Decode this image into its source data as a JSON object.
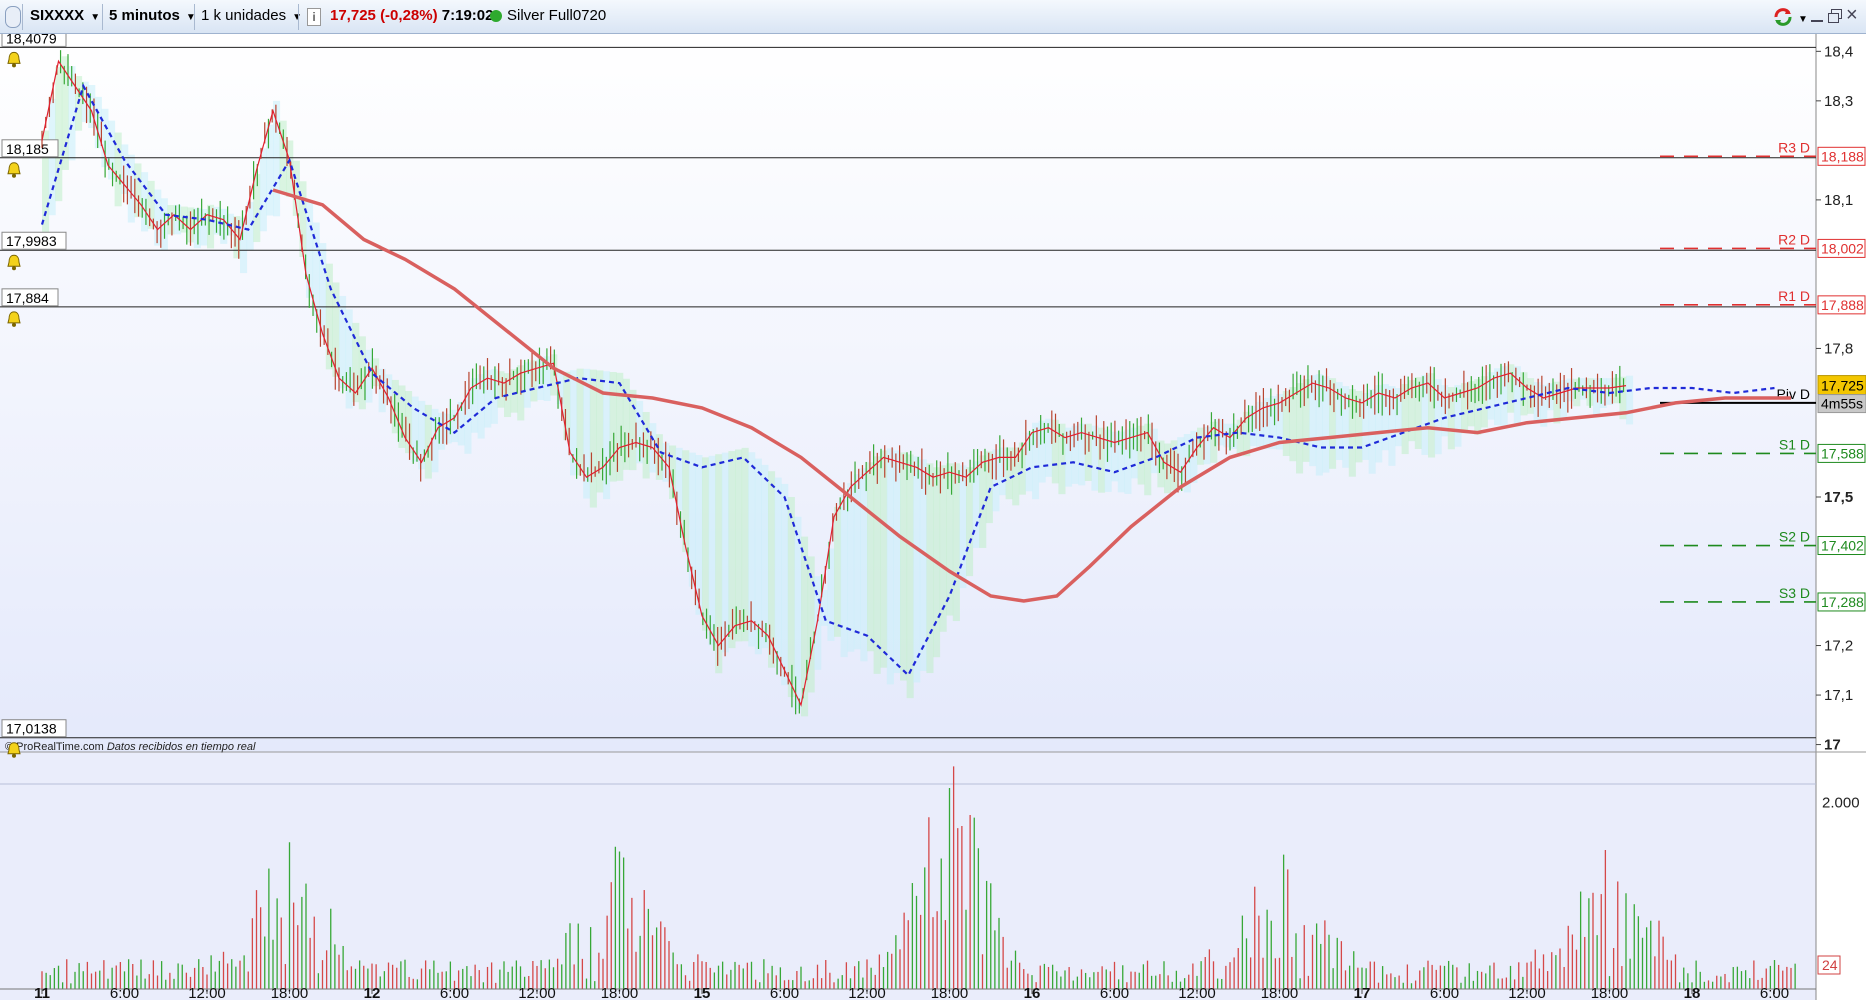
{
  "toolbar": {
    "symbol": "SIXXXX",
    "timeframe": "5 minutos",
    "units": "1 k unidades",
    "price": "17,725",
    "change": "(-0,28%)",
    "time": "7:19:02",
    "account": "Silver Full0720",
    "colors": {
      "price": "#cc0000",
      "status_dot": "#2eaa2e"
    }
  },
  "footer": {
    "copyright": "© ProRealTime.com",
    "note": "Datos recibidos en tiempo real"
  },
  "chart_data": {
    "type": "line",
    "price_panel": {
      "ylim": [
        16.985,
        18.435
      ],
      "y_ticks": [
        {
          "v": 18.4,
          "label": "18,4"
        },
        {
          "v": 18.3,
          "label": "18,3"
        },
        {
          "v": 18.1,
          "label": "18,1"
        },
        {
          "v": 17.8,
          "label": "17,8"
        },
        {
          "v": 17.5,
          "label": "17,5"
        },
        {
          "v": 17.2,
          "label": "17,2"
        },
        {
          "v": 17.1,
          "label": "17,1"
        },
        {
          "v": 17.0,
          "label": "17"
        }
      ],
      "horizontal_lines": [
        {
          "v": 18.4079,
          "label": "18,4079"
        },
        {
          "v": 18.185,
          "label": "18,185"
        },
        {
          "v": 17.9983,
          "label": "17,9983"
        },
        {
          "v": 17.884,
          "label": "17,884"
        },
        {
          "v": 17.0138,
          "label": "17,0138"
        }
      ],
      "pivots": [
        {
          "name": "R3 D",
          "v": 18.188,
          "label": "18,188",
          "color": "#e03030"
        },
        {
          "name": "R2 D",
          "v": 18.002,
          "label": "18,002",
          "color": "#e03030"
        },
        {
          "name": "R1 D",
          "v": 17.888,
          "label": "17,888",
          "color": "#e03030"
        },
        {
          "name": "Piv D",
          "v": 17.69,
          "label": "",
          "color": "#000000"
        },
        {
          "name": "S1 D",
          "v": 17.588,
          "label": "17,588",
          "color": "#1e8a1e"
        },
        {
          "name": "S2 D",
          "v": 17.402,
          "label": "17,402",
          "color": "#1e8a1e"
        },
        {
          "name": "S3 D",
          "v": 17.288,
          "label": "17,288",
          "color": "#1e8a1e"
        }
      ],
      "last_price": {
        "v": 17.725,
        "label": "17,725",
        "countdown": "4m55s"
      },
      "x_ticks": [
        {
          "x": 0,
          "label": "11",
          "major": true
        },
        {
          "x": 1,
          "label": "6:00"
        },
        {
          "x": 2,
          "label": "12:00"
        },
        {
          "x": 3,
          "label": "18:00"
        },
        {
          "x": 4,
          "label": "12",
          "major": true
        },
        {
          "x": 5,
          "label": "6:00"
        },
        {
          "x": 6,
          "label": "12:00"
        },
        {
          "x": 7,
          "label": "18:00"
        },
        {
          "x": 8,
          "label": "15",
          "major": true
        },
        {
          "x": 9,
          "label": "6:00"
        },
        {
          "x": 10,
          "label": "12:00"
        },
        {
          "x": 11,
          "label": "18:00"
        },
        {
          "x": 12,
          "label": "16",
          "major": true
        },
        {
          "x": 13,
          "label": "6:00"
        },
        {
          "x": 14,
          "label": "12:00"
        },
        {
          "x": 15,
          "label": "18:00"
        },
        {
          "x": 16,
          "label": "17",
          "major": true
        },
        {
          "x": 17,
          "label": "6:00"
        },
        {
          "x": 18,
          "label": "12:00"
        },
        {
          "x": 19,
          "label": "18:00"
        },
        {
          "x": 20,
          "label": "18",
          "major": true
        },
        {
          "x": 21,
          "label": "6:00"
        }
      ],
      "price_series": {
        "name": "",
        "x": [
          0,
          0.2,
          0.4,
          0.6,
          0.8,
          1.0,
          1.2,
          1.4,
          1.6,
          1.8,
          2.0,
          2.2,
          2.4,
          2.6,
          2.8,
          3.0,
          3.2,
          3.4,
          3.6,
          3.8,
          4.0,
          4.2,
          4.4,
          4.6,
          4.8,
          5.0,
          5.2,
          5.4,
          5.6,
          5.8,
          6.0,
          6.2,
          6.4,
          6.6,
          6.8,
          7.0,
          7.2,
          7.4,
          7.6,
          7.8,
          8.0,
          8.2,
          8.4,
          8.6,
          8.8,
          9.0,
          9.2,
          9.4,
          9.6,
          9.8,
          10.0,
          10.2,
          10.4,
          10.6,
          10.8,
          11.0,
          11.2,
          11.4,
          11.6,
          11.8,
          12.0,
          12.2,
          12.4,
          12.6,
          12.8,
          13.0,
          13.2,
          13.4,
          13.6,
          13.8,
          14.0,
          14.2,
          14.4,
          14.6,
          14.8,
          15.0,
          15.2,
          15.4,
          15.6,
          15.8,
          16.0,
          16.2,
          16.4,
          16.6,
          16.8,
          17.0,
          17.2,
          17.4,
          17.6,
          17.8,
          18.0,
          18.2,
          18.4,
          18.6,
          18.8,
          19.0,
          19.2,
          19.4,
          19.6,
          19.8,
          20.0,
          20.2,
          20.4,
          20.6,
          20.8,
          21.0,
          21.2
        ],
        "y": [
          18.22,
          18.38,
          18.33,
          18.28,
          18.17,
          18.13,
          18.09,
          18.04,
          18.07,
          18.04,
          18.07,
          18.06,
          18.02,
          18.16,
          18.28,
          18.18,
          17.95,
          17.83,
          17.74,
          17.71,
          17.76,
          17.7,
          17.62,
          17.57,
          17.64,
          17.66,
          17.72,
          17.74,
          17.73,
          17.75,
          17.76,
          17.77,
          17.59,
          17.54,
          17.56,
          17.6,
          17.61,
          17.6,
          17.56,
          17.4,
          17.26,
          17.2,
          17.24,
          17.25,
          17.22,
          17.15,
          17.08,
          17.25,
          17.46,
          17.52,
          17.55,
          17.58,
          17.57,
          17.56,
          17.54,
          17.55,
          17.54,
          17.57,
          17.58,
          17.58,
          17.63,
          17.64,
          17.62,
          17.63,
          17.62,
          17.61,
          17.62,
          17.63,
          17.57,
          17.55,
          17.6,
          17.64,
          17.62,
          17.66,
          17.68,
          17.69,
          17.71,
          17.73,
          17.72,
          17.7,
          17.69,
          17.71,
          17.7,
          17.72,
          17.73,
          17.7,
          17.71,
          17.72,
          17.74,
          17.75,
          17.72,
          17.7,
          17.71,
          17.72,
          17.72,
          17.72,
          17.725
        ]
      },
      "ma_fast": {
        "name": "",
        "x": [
          0,
          0.5,
          1.0,
          1.5,
          2.0,
          2.5,
          3.0,
          3.5,
          4.0,
          4.5,
          5.0,
          5.5,
          6.0,
          6.5,
          7.0,
          7.5,
          8.0,
          8.5,
          9.0,
          9.5,
          10.0,
          10.5,
          11.0,
          11.5,
          12.0,
          12.5,
          13.0,
          13.5,
          14.0,
          14.5,
          15.0,
          15.5,
          16.0,
          16.5,
          17.0,
          17.5,
          18.0,
          18.5,
          19.0,
          19.5,
          20.0,
          20.5,
          21.0
        ],
        "y": [
          18.05,
          18.33,
          18.18,
          18.07,
          18.06,
          18.04,
          18.18,
          17.92,
          17.75,
          17.68,
          17.63,
          17.7,
          17.72,
          17.74,
          17.73,
          17.59,
          17.56,
          17.58,
          17.5,
          17.25,
          17.22,
          17.14,
          17.3,
          17.52,
          17.56,
          17.57,
          17.55,
          17.58,
          17.62,
          17.63,
          17.62,
          17.6,
          17.6,
          17.63,
          17.66,
          17.68,
          17.7,
          17.72,
          17.71,
          17.72,
          17.72,
          17.71,
          17.72
        ]
      },
      "ma_slow": {
        "name": "",
        "x": [
          2.8,
          3.4,
          3.9,
          4.4,
          5.0,
          5.6,
          6.2,
          6.8,
          7.4,
          8.0,
          8.6,
          9.2,
          9.8,
          10.4,
          11.0,
          11.5,
          11.9,
          12.3,
          12.7,
          13.2,
          13.8,
          14.4,
          15.0,
          15.6,
          16.2,
          16.8,
          17.4,
          18.0,
          18.6,
          19.2,
          19.8,
          20.4,
          21.2
        ],
        "y": [
          18.12,
          18.09,
          18.02,
          17.98,
          17.92,
          17.84,
          17.76,
          17.71,
          17.7,
          17.68,
          17.64,
          17.58,
          17.5,
          17.42,
          17.35,
          17.3,
          17.29,
          17.3,
          17.36,
          17.44,
          17.52,
          17.58,
          17.61,
          17.62,
          17.63,
          17.64,
          17.63,
          17.65,
          17.66,
          17.67,
          17.69,
          17.7,
          17.7
        ]
      }
    },
    "volume_panel": {
      "ylim": [
        0,
        2200
      ],
      "y_ticks": [
        {
          "v": 2000,
          "label": "2.000"
        }
      ],
      "last_label": "24"
    }
  }
}
